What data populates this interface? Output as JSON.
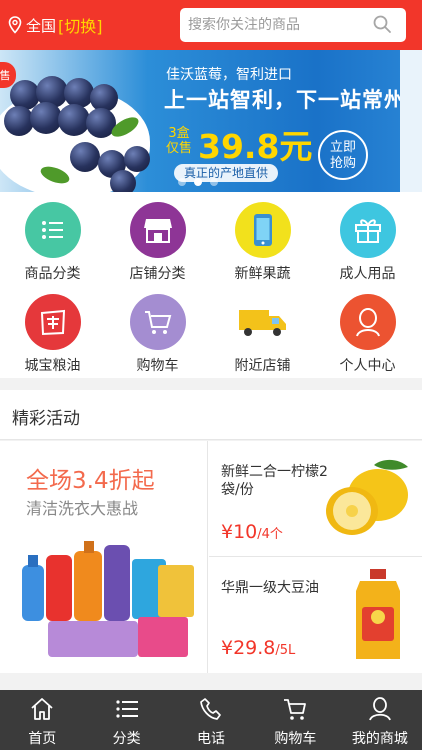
{
  "header": {
    "location": "全国",
    "switch_label": "[切换]",
    "search_placeholder": "搜索你关注的商品"
  },
  "banner": {
    "tag": "售",
    "subtitle": "佳沃蓝莓，智利进口",
    "headline": "上一站智利，下一站常州",
    "qty_top": "3盒",
    "qty_bottom": "仅售",
    "price": "39.8元",
    "origin": "真正的产地直供",
    "button": "立即\n抢购",
    "active_slide": 1
  },
  "categories": [
    {
      "label": "商品分类",
      "icon": "list-icon",
      "color": "#47c7a3"
    },
    {
      "label": "店铺分类",
      "icon": "store-icon",
      "color": "#8e3596"
    },
    {
      "label": "新鲜果蔬",
      "icon": "phone-icon",
      "color": "#f2e11c"
    },
    {
      "label": "成人用品",
      "icon": "gift-icon",
      "color": "#3ec6e0"
    },
    {
      "label": "城宝粮油",
      "icon": "grain-icon",
      "color": "#e5383b"
    },
    {
      "label": "购物车",
      "icon": "cart-icon",
      "color": "#a48dd1"
    },
    {
      "label": "附近店铺",
      "icon": "truck-icon",
      "color": "#ffffff"
    },
    {
      "label": "个人中心",
      "icon": "person-icon",
      "color": "#ec5331"
    }
  ],
  "activity": {
    "title": "精彩活动",
    "promo_title": "全场3.4折起",
    "promo_subtitle": "清洁洗衣大惠战",
    "products": [
      {
        "name": "新鲜二合一柠檬2袋/份",
        "price": "¥10",
        "unit": "/4个"
      },
      {
        "name": "华鼎一级大豆油",
        "price": "¥29.8",
        "unit": "/5L"
      }
    ]
  },
  "nav": [
    {
      "label": "首页",
      "icon": "home-icon"
    },
    {
      "label": "分类",
      "icon": "list-icon"
    },
    {
      "label": "电话",
      "icon": "phone-call-icon"
    },
    {
      "label": "购物车",
      "icon": "cart-icon"
    },
    {
      "label": "我的商城",
      "icon": "user-icon"
    }
  ]
}
